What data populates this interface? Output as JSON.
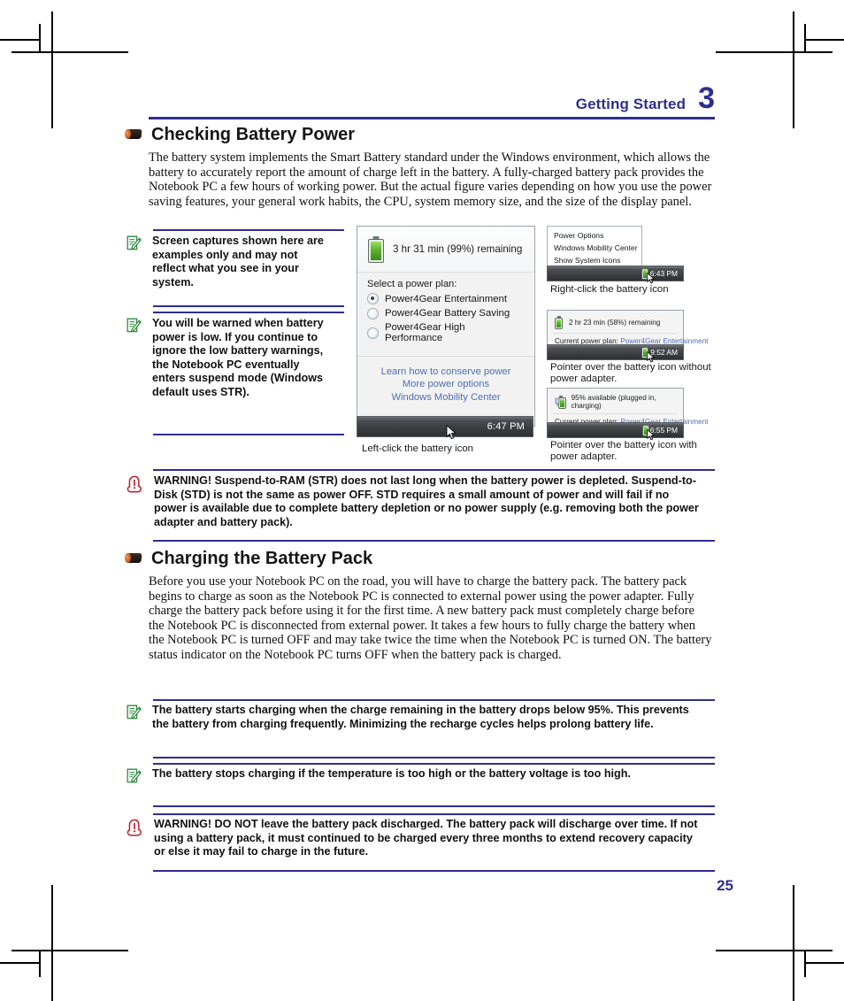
{
  "header": {
    "title": "Getting Started",
    "chapter": "3"
  },
  "sections": {
    "checking": {
      "heading": "Checking Battery Power",
      "body": "The battery system implements the Smart Battery standard under the Windows environment, which allows the battery to accurately report the amount of charge left in the battery. A fully-charged battery pack provides the Notebook PC a few hours of working power. But the actual figure varies depending on how you use the power saving features, your general work habits, the CPU, system memory size, and the size of the display panel."
    },
    "charging": {
      "heading": "Charging the Battery Pack",
      "body": "Before you use your Notebook PC on the road, you will have to charge the battery pack. The battery pack begins to charge as soon as the Notebook PC is connected to external power using the power adapter. Fully charge the battery pack before using it for the first time. A new battery pack must completely charge before the Notebook PC is disconnected from external power. It takes a few hours to fully charge the battery when the Notebook PC is turned OFF and may take twice the time when the Notebook PC is turned ON. The battery status indicator on the Notebook PC turns OFF when the battery pack is charged."
    }
  },
  "notes": {
    "screen_captures": "Screen captures shown here are examples only and may not reflect what you see in your system.",
    "low_battery": "You will be warned when battery power is low. If you continue to ignore the low battery warnings, the Notebook PC eventually enters suspend mode (Windows default uses STR).",
    "charge_threshold": "The battery starts charging when the charge remaining in the battery drops below 95%. This prevents the battery from charging frequently. Minimizing the recharge cycles helps prolong battery life.",
    "stops_charging": "The battery stops charging if the temperature is too high or the battery voltage is too high."
  },
  "warnings": {
    "suspend": "WARNING!  Suspend-to-RAM (STR) does not last long when the battery power is depleted. Suspend-to-Disk (STD) is not the same as power OFF. STD requires a small amount of power and will fail if no power is available due to complete battery depletion or no power supply (e.g. removing both the power adapter and battery pack).",
    "discharged": "WARNING!  DO NOT leave the battery pack discharged. The battery pack will discharge over time. If not using a battery pack, it must continued to be charged every three months to extend recovery capacity or else it may fail to charge in the future."
  },
  "figures": {
    "flyout": {
      "remaining": "3 hr 31 min (99%) remaining",
      "select_label": "Select a power plan:",
      "plans": [
        {
          "label": "Power4Gear Entertainment",
          "selected": true
        },
        {
          "label": "Power4Gear Battery Saving",
          "selected": false
        },
        {
          "label": "Power4Gear High Performance",
          "selected": false
        }
      ],
      "links": [
        "Learn how to conserve power",
        "More power options",
        "Windows Mobility Center"
      ],
      "taskbar_time": "6:47 PM",
      "caption": "Left-click the battery icon"
    },
    "context_menu": {
      "items": [
        "Power Options",
        "Windows Mobility Center",
        "Show System Icons"
      ],
      "taskbar_time": "6:43 PM",
      "caption": "Right-click the battery icon"
    },
    "tooltip_no_adapter": {
      "status": "2 hr 23 min (58%) remaining",
      "plan_label": "Current power plan:",
      "plan_value": "Power4Gear Entertainment",
      "taskbar_time": "9:52 AM",
      "caption": "Pointer over the battery icon without power adapter."
    },
    "tooltip_with_adapter": {
      "status": "95% available (plugged in, charging)",
      "plan_label": "Current power plan:",
      "plan_value": "Power4Gear Entertainment",
      "taskbar_time": "6:55 PM",
      "caption": "Pointer over the battery icon with power adapter."
    }
  },
  "page_number": "25",
  "colors": {
    "accent": "#2d2f8f",
    "note_green": "#2e8b3d",
    "warn_red": "#c02028",
    "link_blue": "#4f6fb5"
  }
}
